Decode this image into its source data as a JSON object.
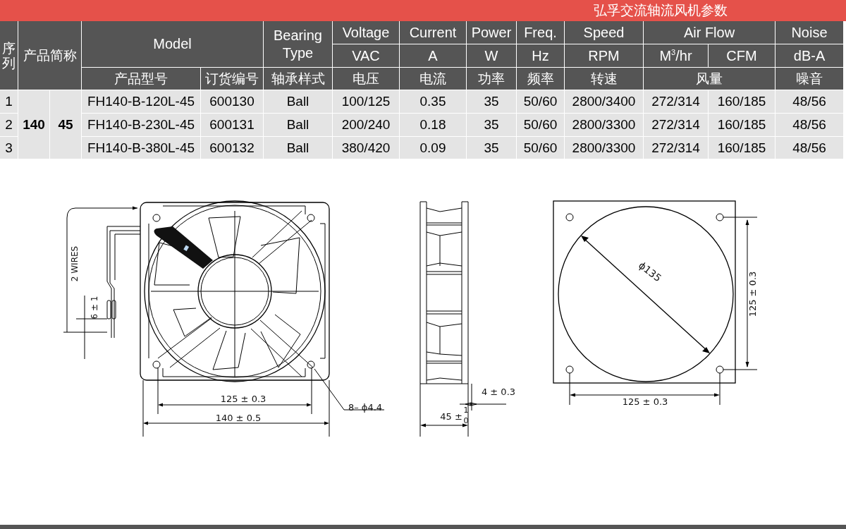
{
  "banner": {
    "title": "弘孚交流轴流风机参数"
  },
  "table": {
    "header_rows": [
      [
        "序列",
        "产品简称",
        "Model",
        "Bearing Type",
        "Voltage",
        "Current",
        "Power",
        "Freq.",
        "Speed",
        "Air Flow",
        "Noise"
      ],
      [
        "VAC",
        "A",
        "W",
        "Hz",
        "RPM",
        "M$^{3}$/hr",
        "CFM",
        "dB-A"
      ],
      [
        "产品型号",
        "订货编号",
        "轴承样式",
        "电压",
        "电流",
        "功率",
        "频率",
        "转速",
        "风量",
        "噪音"
      ]
    ],
    "group": {
      "size": "140",
      "thickness": "45"
    },
    "rows": [
      {
        "index": "1",
        "cells": [
          "FH140-B-120L-45",
          "600130",
          "Ball",
          "100/125",
          "0.35",
          "35",
          "50/60",
          "2800/3400",
          "272/314",
          "160/185",
          "48/56"
        ]
      },
      {
        "index": "2",
        "cells": [
          "FH140-B-230L-45",
          "600131",
          "Ball",
          "200/240",
          "0.18",
          "35",
          "50/60",
          "2800/3300",
          "272/314",
          "160/185",
          "48/56"
        ]
      },
      {
        "index": "3",
        "cells": [
          "FH140-B-380L-45",
          "600132",
          "Ball",
          "380/420",
          "0.09",
          "35",
          "50/60",
          "2800/3300",
          "272/314",
          "160/185",
          "48/56"
        ]
      }
    ]
  },
  "drawings": {
    "front_view": {
      "labels": [
        "2 WIRES",
        "6 ± 1",
        "125 ± 0.3",
        "140 ± 0.5",
        "8– ϕ4.4"
      ]
    },
    "side_view": {
      "labels": [
        "4 ± 0.3",
        "45 ±",
        "1",
        "0"
      ]
    },
    "mounting_template": {
      "labels": [
        "ϕ135",
        "125 ± 0.3",
        "125 ± 0.3"
      ]
    }
  }
}
